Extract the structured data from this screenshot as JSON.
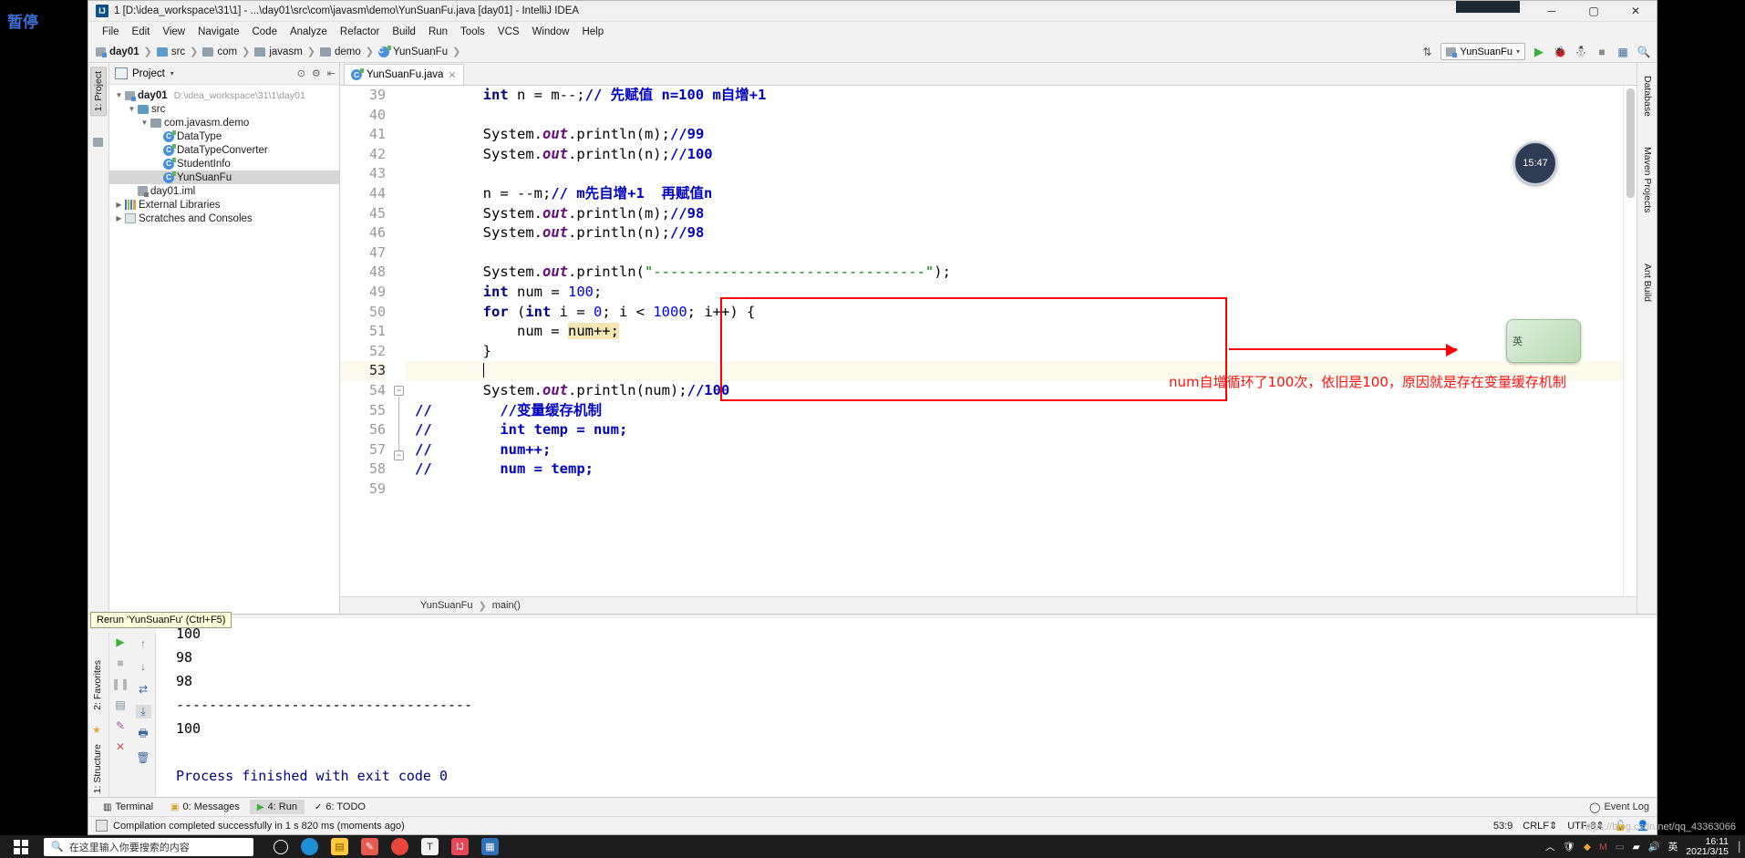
{
  "overlay": {
    "pause_label": "暂停"
  },
  "titlebar": {
    "title": "1 [D:\\idea_workspace\\31\\1] - ...\\day01\\src\\com\\javasm\\demo\\YunSuanFu.java [day01] - IntelliJ IDEA",
    "logo": "IJ",
    "minimize": "─",
    "maximize": "▢",
    "close": "✕"
  },
  "menubar": {
    "items": [
      "File",
      "Edit",
      "View",
      "Navigate",
      "Code",
      "Analyze",
      "Refactor",
      "Build",
      "Run",
      "Tools",
      "VCS",
      "Window",
      "Help"
    ]
  },
  "navbar": {
    "crumbs": [
      {
        "label": "day01",
        "icon": "module-icon"
      },
      {
        "label": "src",
        "icon": "folder-icon"
      },
      {
        "label": "com",
        "icon": "package-icon"
      },
      {
        "label": "javasm",
        "icon": "package-icon"
      },
      {
        "label": "demo",
        "icon": "package-icon"
      },
      {
        "label": "YunSuanFu",
        "icon": "java-class-icon"
      }
    ],
    "run_config": "YunSuanFu",
    "buttons": [
      "run-button",
      "debug-button",
      "run-coverage-button",
      "stop-button",
      "database-button",
      "search-button"
    ]
  },
  "left_strip": {
    "tabs": [
      "1: Project"
    ]
  },
  "right_strip": {
    "tabs": [
      "Database",
      "Maven Projects",
      "Ant Build"
    ]
  },
  "project_panel": {
    "title": "Project",
    "tree": [
      {
        "indent": 0,
        "arrow": "v",
        "icon": "module-icon",
        "label": "day01",
        "path": "D:\\idea_workspace\\31\\1\\day01",
        "selected": false,
        "bold": true
      },
      {
        "indent": 1,
        "arrow": "v",
        "icon": "folder-icon",
        "label": "src",
        "path": "",
        "selected": false,
        "bold": false
      },
      {
        "indent": 2,
        "arrow": "v",
        "icon": "package-icon",
        "label": "com.javasm.demo",
        "path": "",
        "selected": false,
        "bold": false
      },
      {
        "indent": 3,
        "arrow": "",
        "icon": "java-class-icon",
        "label": "DataType",
        "path": "",
        "selected": false,
        "bold": false
      },
      {
        "indent": 3,
        "arrow": "",
        "icon": "java-class-icon",
        "label": "DataTypeConverter",
        "path": "",
        "selected": false,
        "bold": false
      },
      {
        "indent": 3,
        "arrow": "",
        "icon": "java-class-icon",
        "label": "StudentInfo",
        "path": "",
        "selected": false,
        "bold": false
      },
      {
        "indent": 3,
        "arrow": "",
        "icon": "java-class-icon",
        "label": "YunSuanFu",
        "path": "",
        "selected": true,
        "bold": false
      },
      {
        "indent": 1,
        "arrow": "",
        "icon": "iml-icon",
        "label": "day01.iml",
        "path": "",
        "selected": false,
        "bold": false
      },
      {
        "indent": 0,
        "arrow": ">",
        "icon": "library-icon",
        "label": "External Libraries",
        "path": "",
        "selected": false,
        "bold": false
      },
      {
        "indent": 0,
        "arrow": ">",
        "icon": "scratches-icon",
        "label": "Scratches and Consoles",
        "path": "",
        "selected": false,
        "bold": false
      }
    ]
  },
  "editor": {
    "tab": {
      "label": "YunSuanFu.java",
      "close": "✕"
    },
    "first_line": 39,
    "current_line": 53,
    "breadcrumb": [
      "YunSuanFu",
      "main()"
    ],
    "lines": [
      {
        "n": 39,
        "html": "        <span class='kw'>int</span> n = m--;<span class='cmt-b'>// 先赋值 n=100 m自增+1</span>"
      },
      {
        "n": 40,
        "html": ""
      },
      {
        "n": 41,
        "html": "        System.<span class='fld'>out</span>.println(m);<span class='cmt-b'>//99</span>"
      },
      {
        "n": 42,
        "html": "        System.<span class='fld'>out</span>.println(n);<span class='cmt-b'>//100</span>"
      },
      {
        "n": 43,
        "html": ""
      },
      {
        "n": 44,
        "html": "        n = --m;<span class='cmt-b'>// m先自增+1  再赋值n</span>"
      },
      {
        "n": 45,
        "html": "        System.<span class='fld'>out</span>.println(m);<span class='cmt-b'>//98</span>"
      },
      {
        "n": 46,
        "html": "        System.<span class='fld'>out</span>.println(n);<span class='cmt-b'>//98</span>"
      },
      {
        "n": 47,
        "html": ""
      },
      {
        "n": 48,
        "html": "        System.<span class='fld'>out</span>.println(<span class='str'>\"--------------------------------\"</span>);"
      },
      {
        "n": 49,
        "html": "        <span class='kw'>int</span> num = <span class='num'>100</span>;"
      },
      {
        "n": 50,
        "html": "        <span class='kw'>for</span> (<span class='kw'>int</span> i = <span class='num'>0</span>; i &lt; <span class='num'>1000</span>; i++) {"
      },
      {
        "n": 51,
        "html": "            num = <span class='hl'>num++;</span>"
      },
      {
        "n": 52,
        "html": "        }"
      },
      {
        "n": 53,
        "html": "        <span class='caret'></span>"
      },
      {
        "n": 54,
        "html": "        System.<span class='fld'>out</span>.println(num);<span class='cmt-b'>//100</span>"
      },
      {
        "n": 55,
        "html": "<span class='cmt-b'>//</span>        <span class='cmt-b'>//变量缓存机制</span>"
      },
      {
        "n": 56,
        "html": "<span class='cmt-b'>//</span>        <span class='cmt-b'>int temp = num;</span>"
      },
      {
        "n": 57,
        "html": "<span class='cmt-b'>//</span>        <span class='cmt-b'>num++;</span>"
      },
      {
        "n": 58,
        "html": "<span class='cmt-b'>//</span>        <span class='cmt-b'>num = temp;</span>"
      },
      {
        "n": 59,
        "html": ""
      }
    ],
    "annotation": "num自增循环了100次，依旧是100，原因就是存在变量缓存机制"
  },
  "run_panel": {
    "tooltip": "Rerun 'YunSuanFu' (Ctrl+F5)",
    "vtabs": [
      "2: Favorites",
      "1: Structure"
    ],
    "console": [
      {
        "text": "100",
        "blue": false
      },
      {
        "text": "98",
        "blue": false
      },
      {
        "text": "98",
        "blue": false
      },
      {
        "text": "------------------------------------",
        "blue": false
      },
      {
        "text": "100",
        "blue": false
      },
      {
        "text": "",
        "blue": false
      },
      {
        "text": "Process finished with exit code 0",
        "blue": true
      }
    ],
    "toolbar": [
      "rerun-button",
      "stop-button",
      "pause-button",
      "print-button",
      "clear-button",
      "trash-button",
      "close-button"
    ]
  },
  "tool_window_bar": {
    "tabs": [
      {
        "label": "Terminal",
        "selected": false,
        "icon": "terminal-icon"
      },
      {
        "label": "0: Messages",
        "selected": false,
        "icon": "messages-icon"
      },
      {
        "label": "4: Run",
        "selected": true,
        "icon": "run-icon"
      },
      {
        "label": "6: TODO",
        "selected": false,
        "icon": "todo-icon"
      }
    ],
    "event_log": "Event Log"
  },
  "statusbar": {
    "message": "Compilation completed successfully in 1 s 820 ms (moments ago)",
    "caret": "53:9",
    "line_sep": "CRLF",
    "encoding": "UTF-8"
  },
  "taskbar": {
    "search_placeholder": "在这里输入你要搜索的内容",
    "ime": "英",
    "time": "16:11",
    "date": "2021/3/15",
    "apps": [
      "cortana-icon",
      "edge-icon",
      "explorer-icon",
      "paint-icon",
      "chrome-icon",
      "typora-icon",
      "idea-icon",
      "calc-icon"
    ]
  },
  "watermark": "https://blog.csdn.net/qq_43363066",
  "floating": {
    "clock_time": "15:47",
    "ime_label": "英"
  },
  "colors": {
    "accent_red": "#ff0000",
    "run_green": "#3ab03a",
    "keyword_blue": "#000080",
    "string_green": "#008000"
  }
}
